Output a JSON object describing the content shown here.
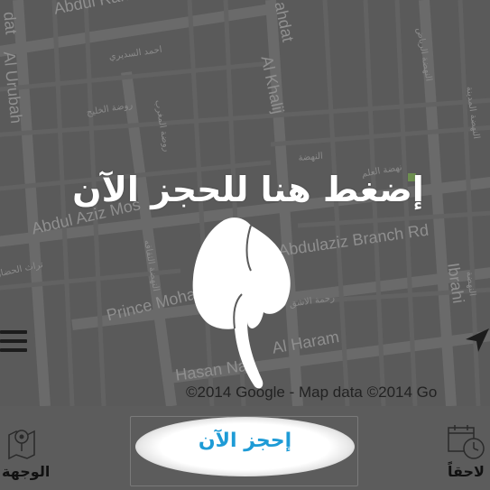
{
  "map": {
    "streets": [
      {
        "text": "Abdul Rahman Ibn N"
      },
      {
        "text": "Al Khalij"
      },
      {
        "text": "ahdat"
      },
      {
        "text": "Al Urubah"
      },
      {
        "text": "dat"
      },
      {
        "text": "Abdul Aziz Mos"
      },
      {
        "text": "Abdulaziz Branch Rd"
      },
      {
        "text": "Prince Moha"
      },
      {
        "text": "Al Haram"
      },
      {
        "text": "Hasan Na"
      },
      {
        "text": "Ibrahi"
      }
    ],
    "arabic_labels": [
      {
        "text": "احمد السديري"
      },
      {
        "text": "روضة الخليج"
      },
      {
        "text": "روضة المغرب"
      },
      {
        "text": "النهضة"
      },
      {
        "text": "نهضة العلم"
      },
      {
        "text": "النهضة الرياض"
      },
      {
        "text": "النهضة المدينة"
      },
      {
        "text": "النهضة"
      },
      {
        "text": "تراث الحضارة"
      },
      {
        "text": "رحمة الاشق"
      },
      {
        "text": "النهضة الثقافه"
      }
    ],
    "attribution": "©2014 Google - Map data ©2014 Go"
  },
  "overlay": {
    "hint": "إضغط هنا للحجز الآن"
  },
  "icons": {
    "menu": "hamburger-menu-icon",
    "locate": "navigation-arrow-icon",
    "hand": "pointing-hand-icon",
    "destination": "map-pin-icon",
    "later": "calendar-clock-icon"
  },
  "bottom_bar": {
    "book_now": "إحجز الآن",
    "destination": "الوجهة",
    "later": "لاحقاً"
  },
  "colors": {
    "book_text": "#1e9bd6",
    "background": "#5c5c5c"
  }
}
